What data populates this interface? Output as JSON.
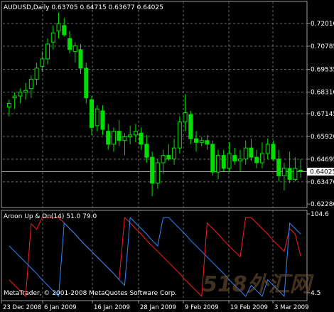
{
  "main_panel": {
    "title": "AUDUSD,Daily  0.63705  0.64715  0.63677  0.64025",
    "current_price_label": "0.64025",
    "price_ticks": [
      "0.72010",
      "0.70785",
      "0.69535",
      "0.68310",
      "0.67145",
      "0.65920",
      "0.64695",
      "0.63470",
      "0.62280"
    ]
  },
  "indicator_panel": {
    "title": "Aroon Up & Dn(14) 51.0 79.0",
    "ticks": [
      "104.6",
      "4.5"
    ]
  },
  "x_axis": {
    "date_labels": [
      "23 Dec 2008",
      "6 Jan 2009",
      "16 Jan 2009",
      "28 Jan 2009",
      "9 Feb 2009",
      "19 Feb 2009",
      "3 Mar 2009"
    ]
  },
  "footer": {
    "copyright": "MetaTrader, © 2001-2008 MetaQuotes Software Corp."
  },
  "watermark": {
    "text": "518外汇网"
  },
  "colors": {
    "background": "#000000",
    "candles": "#00e000",
    "aroon_up": "#ff1a1a",
    "aroon_down": "#2f86ff",
    "grid": "#6d6d6d"
  },
  "chart_data": [
    {
      "type": "candlestick",
      "title": "AUDUSD,Daily",
      "ylim": [
        0.6228,
        0.7201
      ],
      "candles": [
        {
          "o": 0.675,
          "h": 0.679,
          "l": 0.67,
          "c": 0.677
        },
        {
          "o": 0.68,
          "h": 0.683,
          "l": 0.674,
          "c": 0.681
        },
        {
          "o": 0.681,
          "h": 0.685,
          "l": 0.677,
          "c": 0.683
        },
        {
          "o": 0.683,
          "h": 0.688,
          "l": 0.679,
          "c": 0.684
        },
        {
          "o": 0.685,
          "h": 0.692,
          "l": 0.68,
          "c": 0.69
        },
        {
          "o": 0.69,
          "h": 0.699,
          "l": 0.687,
          "c": 0.696
        },
        {
          "o": 0.697,
          "h": 0.705,
          "l": 0.694,
          "c": 0.701
        },
        {
          "o": 0.701,
          "h": 0.712,
          "l": 0.698,
          "c": 0.709
        },
        {
          "o": 0.71,
          "h": 0.719,
          "l": 0.706,
          "c": 0.715
        },
        {
          "o": 0.716,
          "h": 0.726,
          "l": 0.712,
          "c": 0.72
        },
        {
          "o": 0.719,
          "h": 0.723,
          "l": 0.713,
          "c": 0.714
        },
        {
          "o": 0.712,
          "h": 0.716,
          "l": 0.704,
          "c": 0.706
        },
        {
          "o": 0.705,
          "h": 0.71,
          "l": 0.699,
          "c": 0.708
        },
        {
          "o": 0.706,
          "h": 0.709,
          "l": 0.693,
          "c": 0.696
        },
        {
          "o": 0.696,
          "h": 0.699,
          "l": 0.677,
          "c": 0.68
        },
        {
          "o": 0.679,
          "h": 0.681,
          "l": 0.66,
          "c": 0.664
        },
        {
          "o": 0.665,
          "h": 0.676,
          "l": 0.662,
          "c": 0.674
        },
        {
          "o": 0.673,
          "h": 0.676,
          "l": 0.66,
          "c": 0.663
        },
        {
          "o": 0.662,
          "h": 0.666,
          "l": 0.652,
          "c": 0.655
        },
        {
          "o": 0.655,
          "h": 0.664,
          "l": 0.651,
          "c": 0.662
        },
        {
          "o": 0.662,
          "h": 0.668,
          "l": 0.654,
          "c": 0.657
        },
        {
          "o": 0.657,
          "h": 0.661,
          "l": 0.649,
          "c": 0.659
        },
        {
          "o": 0.659,
          "h": 0.665,
          "l": 0.655,
          "c": 0.66
        },
        {
          "o": 0.66,
          "h": 0.666,
          "l": 0.656,
          "c": 0.662
        },
        {
          "o": 0.661,
          "h": 0.664,
          "l": 0.652,
          "c": 0.655
        },
        {
          "o": 0.655,
          "h": 0.66,
          "l": 0.645,
          "c": 0.648
        },
        {
          "o": 0.648,
          "h": 0.651,
          "l": 0.627,
          "c": 0.634
        },
        {
          "o": 0.634,
          "h": 0.647,
          "l": 0.631,
          "c": 0.645
        },
        {
          "o": 0.645,
          "h": 0.652,
          "l": 0.639,
          "c": 0.649
        },
        {
          "o": 0.649,
          "h": 0.655,
          "l": 0.646,
          "c": 0.647
        },
        {
          "o": 0.647,
          "h": 0.658,
          "l": 0.644,
          "c": 0.653
        },
        {
          "o": 0.653,
          "h": 0.67,
          "l": 0.65,
          "c": 0.667
        },
        {
          "o": 0.667,
          "h": 0.682,
          "l": 0.662,
          "c": 0.672
        },
        {
          "o": 0.671,
          "h": 0.673,
          "l": 0.655,
          "c": 0.658
        },
        {
          "o": 0.658,
          "h": 0.662,
          "l": 0.651,
          "c": 0.656
        },
        {
          "o": 0.656,
          "h": 0.659,
          "l": 0.654,
          "c": 0.657
        },
        {
          "o": 0.657,
          "h": 0.66,
          "l": 0.652,
          "c": 0.655
        },
        {
          "o": 0.655,
          "h": 0.657,
          "l": 0.638,
          "c": 0.64
        },
        {
          "o": 0.64,
          "h": 0.652,
          "l": 0.636,
          "c": 0.649
        },
        {
          "o": 0.649,
          "h": 0.652,
          "l": 0.64,
          "c": 0.642
        },
        {
          "o": 0.642,
          "h": 0.656,
          "l": 0.64,
          "c": 0.65
        },
        {
          "o": 0.649,
          "h": 0.653,
          "l": 0.644,
          "c": 0.646
        },
        {
          "o": 0.646,
          "h": 0.652,
          "l": 0.64,
          "c": 0.647
        },
        {
          "o": 0.647,
          "h": 0.657,
          "l": 0.644,
          "c": 0.653
        },
        {
          "o": 0.653,
          "h": 0.658,
          "l": 0.646,
          "c": 0.648
        },
        {
          "o": 0.648,
          "h": 0.652,
          "l": 0.642,
          "c": 0.645
        },
        {
          "o": 0.645,
          "h": 0.656,
          "l": 0.642,
          "c": 0.65
        },
        {
          "o": 0.65,
          "h": 0.658,
          "l": 0.647,
          "c": 0.655
        },
        {
          "o": 0.655,
          "h": 0.657,
          "l": 0.646,
          "c": 0.647
        },
        {
          "o": 0.647,
          "h": 0.652,
          "l": 0.635,
          "c": 0.638
        },
        {
          "o": 0.638,
          "h": 0.645,
          "l": 0.63,
          "c": 0.642
        },
        {
          "o": 0.642,
          "h": 0.651,
          "l": 0.634,
          "c": 0.636
        },
        {
          "o": 0.636,
          "h": 0.648,
          "l": 0.635,
          "c": 0.642
        },
        {
          "o": 0.641,
          "h": 0.647,
          "l": 0.6368,
          "c": 0.6403
        }
      ]
    },
    {
      "type": "line",
      "title": "Aroon Up & Dn(14) 51.0 79.0",
      "ylim": [
        4.5,
        104.6
      ],
      "series": [
        {
          "values": [
            21,
            14,
            7,
            0,
            92,
            85,
            100,
            100,
            100,
            100,
            93,
            86,
            79,
            71,
            64,
            57,
            50,
            43,
            36,
            29,
            21,
            100,
            93,
            86,
            79,
            71,
            64,
            57,
            50,
            43,
            36,
            29,
            21,
            14,
            7,
            0,
            93,
            86,
            79,
            71,
            64,
            57,
            50,
            100,
            100,
            93,
            86,
            79,
            71,
            64,
            57,
            86,
            79,
            51
          ]
        },
        {
          "values": [
            64,
            57,
            50,
            43,
            36,
            29,
            21,
            14,
            7,
            0,
            93,
            86,
            79,
            71,
            64,
            57,
            50,
            43,
            36,
            29,
            21,
            14,
            100,
            93,
            86,
            79,
            71,
            64,
            100,
            100,
            93,
            86,
            79,
            71,
            64,
            57,
            50,
            43,
            36,
            29,
            21,
            14,
            7,
            0,
            14,
            7,
            0,
            21,
            14,
            7,
            0,
            93,
            86,
            79
          ]
        }
      ]
    }
  ]
}
